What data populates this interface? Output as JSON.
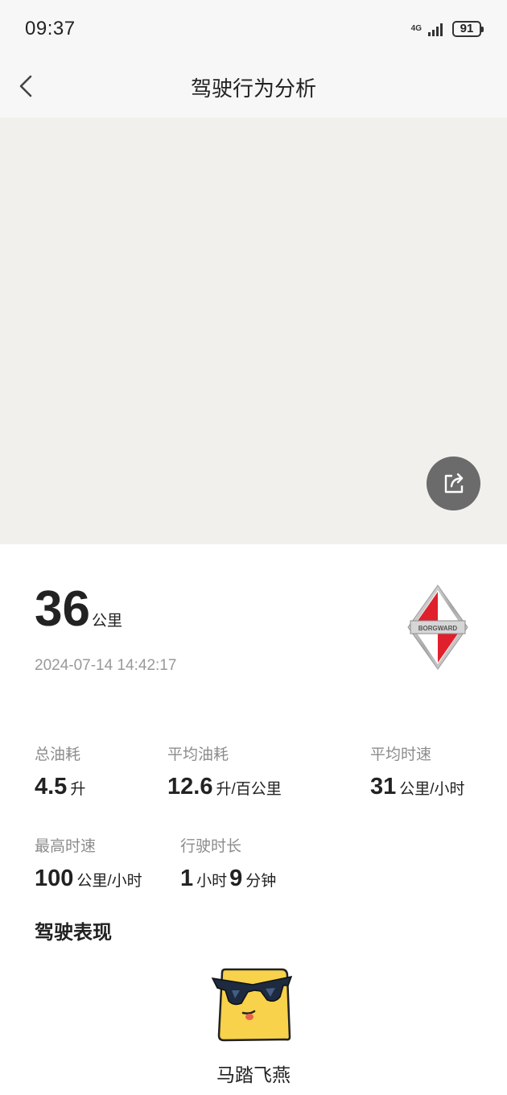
{
  "status_bar": {
    "time": "09:37",
    "network": "4G",
    "battery": "91"
  },
  "header": {
    "title": "驾驶行为分析",
    "back_icon": "chevron-left-icon"
  },
  "map": {
    "share_icon": "share-icon"
  },
  "trip": {
    "distance": "36",
    "distance_unit": "公里",
    "datetime": "2024-07-14 14:42:17",
    "brand_logo_text": "BORGWARD"
  },
  "stats": {
    "total_fuel": {
      "label": "总油耗",
      "value": "4.5",
      "unit": "升"
    },
    "avg_fuel": {
      "label": "平均油耗",
      "value": "12.6",
      "unit": "升/百公里"
    },
    "avg_speed": {
      "label": "平均时速",
      "value": "31",
      "unit": "公里/小时"
    },
    "max_speed": {
      "label": "最高时速",
      "value": "100",
      "unit": "公里/小时"
    },
    "duration": {
      "label": "行驶时长",
      "hours": "1",
      "hours_unit": "小时",
      "minutes": "9",
      "minutes_unit": "分钟"
    }
  },
  "performance": {
    "title": "驾驶表现",
    "label": "马踏飞燕",
    "icon": "cool-face-icon"
  },
  "colors": {
    "map_bg": "#f1f0ec",
    "share_bg": "#6b6b6b",
    "logo_red": "#e0202c"
  }
}
